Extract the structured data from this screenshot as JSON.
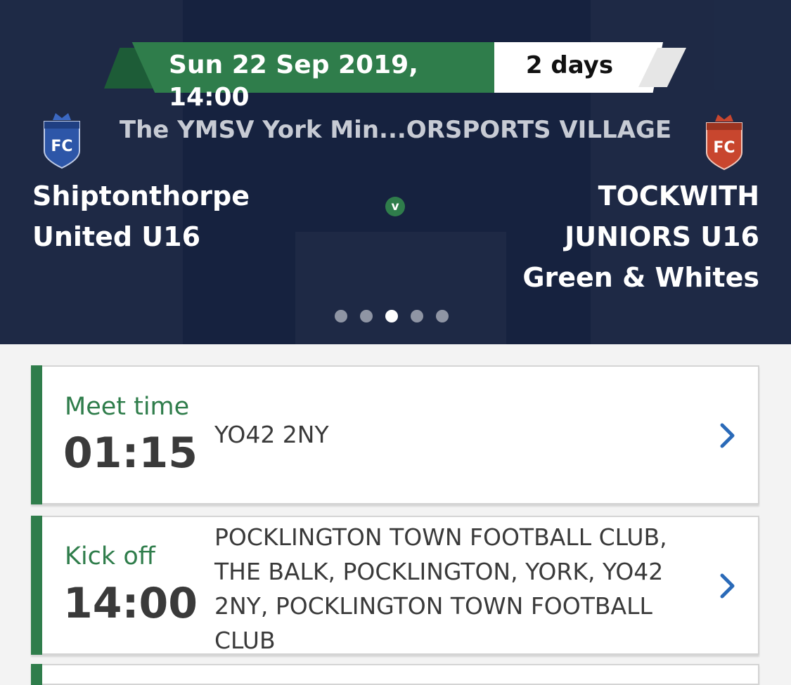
{
  "fixture": {
    "date_time": "Sun 22 Sep 2019, 14:00",
    "countdown": "2 days",
    "venue": "The YMSV York Min...ORSPORTS VILLAGE",
    "versus_label": "v",
    "home_team": {
      "line1": "Shiptonthorpe",
      "line2": "United U16",
      "crest_text": "FC",
      "crest_color": "#2d56a8",
      "crown_color": "#3b68c2"
    },
    "away_team": {
      "line1": "TOCKWITH",
      "line2": "JUNIORS U16",
      "line3": "Green & Whites",
      "crest_text": "FC",
      "crest_color": "#c8462e",
      "crown_color": "#c8462e"
    },
    "carousel": {
      "pages": 5,
      "active_index": 2
    }
  },
  "cards": {
    "meet": {
      "label": "Meet time",
      "time": "01:15",
      "detail": "YO42 2NY"
    },
    "kickoff": {
      "label": "Kick off",
      "time": "14:00",
      "detail_lines": [
        "POCKLINGTON TOWN FOOTBALL CLUB,",
        "THE BALK, POCKLINGTON, YORK, YO42",
        "2NY, POCKLINGTON TOWN FOOTBALL",
        "CLUB"
      ]
    }
  },
  "icons": {
    "crest": "shield-crest-icon",
    "chevron": "chevron-right-icon"
  },
  "colors": {
    "header_bg": "#16223f",
    "accent_green": "#2f7d4b",
    "chevron_blue": "#2a6ab8"
  }
}
